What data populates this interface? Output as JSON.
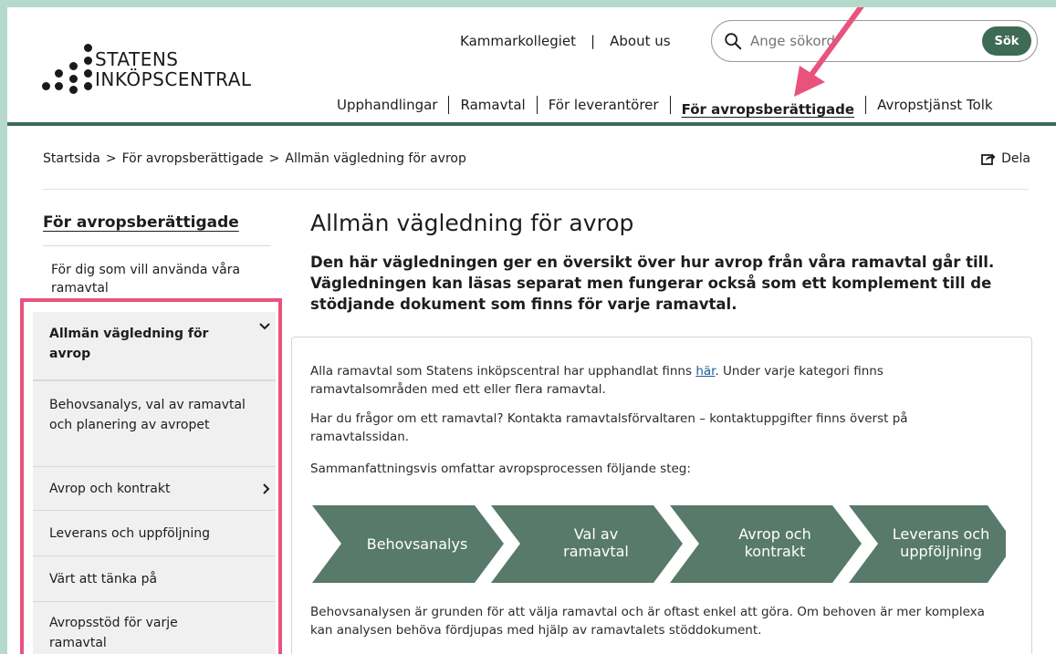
{
  "header": {
    "logo_line1": "STATENS",
    "logo_line2": "INKÖPSCENTRAL",
    "utility_links": [
      "Kammarkollegiet",
      "About us"
    ],
    "search_placeholder": "Ange sökord",
    "search_button": "Sök",
    "nav": [
      "Upphandlingar",
      "Ramavtal",
      "För leverantörer",
      "För avropsberättigade",
      "Avropstjänst Tolk"
    ]
  },
  "breadcrumb": [
    "Startsida",
    "För avropsberättigade",
    "Allmän vägledning för avrop"
  ],
  "breadcrumb_separator": ">",
  "share_label": "Dela",
  "sidebar": {
    "title": "För avropsberättigade",
    "intro": "För dig som vill använda våra ramavtal",
    "items": [
      {
        "label": "Allmän vägledning för avrop",
        "active": true,
        "chevron": "chevron-down-icon"
      },
      {
        "label": "Behovsanalys, val av ramavtal och planering av avropet"
      },
      {
        "label": "Avrop och kontrakt",
        "chevron": "chevron-right-icon"
      },
      {
        "label": "Leverans och uppföljning"
      },
      {
        "label": "Värt att tänka på"
      },
      {
        "label": "Avropsstöd för varje ramavtal"
      }
    ]
  },
  "main": {
    "title": "Allmän vägledning för avrop",
    "lead": "Den här vägledningen ger en översikt över hur avrop från våra ramavtal går till. Vägledningen kan läsas separat men fungerar också som ett komplement till de stödjande dokument som finns för varje ramavtal.",
    "p1_before": "Alla ramavtal som Statens inköpscentral har upphandlat finns ",
    "p1_link": "här",
    "p1_after": ". Under varje kategori finns ramavtalsområden med ett eller flera ramavtal.",
    "p2": "Har du frågor om ett ramavtal? Kontakta ramavtalsförvaltaren – kontaktuppgifter finns överst på ramavtalssidan.",
    "p3": "Sammanfattningsvis omfattar avropsprocessen följande steg:",
    "steps": [
      {
        "line1": "Behovsanalys",
        "line2": ""
      },
      {
        "line1": "Val av",
        "line2": "ramavtal"
      },
      {
        "line1": "Avrop och",
        "line2": "kontrakt"
      },
      {
        "line1": "Leverans och",
        "line2": "uppföljning"
      }
    ],
    "p4": "Behovsanalysen är grunden för att välja ramavtal och är oftast enkel att göra. Om behoven är mer komplexa kan analysen behöva fördjupas med hjälp av ramavtalets stöddokument."
  },
  "colors": {
    "accent_green": "#3d6b55",
    "step_green": "#577a6a",
    "highlight_pink": "#e8537e",
    "frame_bg": "#b6d9cd"
  }
}
